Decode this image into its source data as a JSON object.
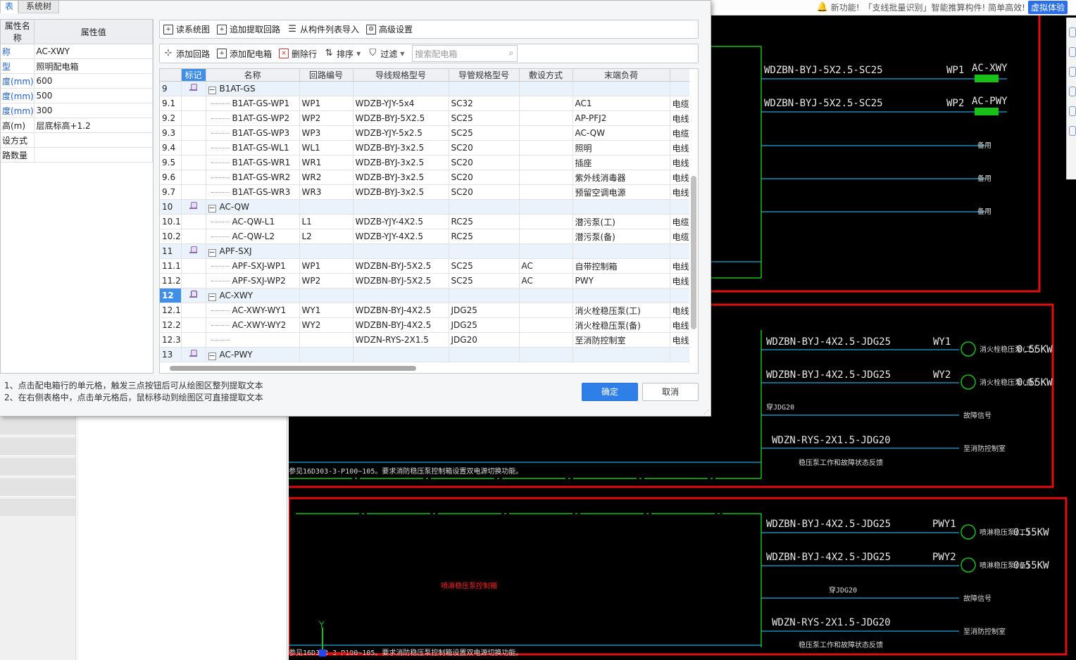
{
  "tabs": [
    "表",
    "系统树"
  ],
  "properties": {
    "header": {
      "name": "属性名称",
      "value": "属性值"
    },
    "rows": [
      {
        "key": "称",
        "value": "AC-XWY",
        "blue": true
      },
      {
        "key": "型",
        "value": "照明配电箱",
        "blue": true
      },
      {
        "key": "度(mm)",
        "value": "600",
        "blue": true
      },
      {
        "key": "度(mm)",
        "value": "500",
        "blue": true
      },
      {
        "key": "度(mm)",
        "value": "300",
        "blue": true
      },
      {
        "key": "高(m)",
        "value": "层底标高+1.2",
        "blue": false
      },
      {
        "key": "设方式",
        "value": "",
        "blue": false
      },
      {
        "key": "路数量",
        "value": "",
        "blue": false
      }
    ]
  },
  "toolbar1": {
    "read_system": "读系统图",
    "append_extract": "追加提取回路",
    "import_list": "从构件列表导入",
    "advanced": "高级设置"
  },
  "toolbar2": {
    "add_circuit": "添加回路",
    "add_box": "添加配电箱",
    "delete_row": "删除行",
    "sort": "排序",
    "filter": "过滤",
    "search_placeholder": "搜索配电箱"
  },
  "grid": {
    "headers": [
      "",
      "标记",
      "名称",
      "回路编号",
      "导线规格型号",
      "导管规格型号",
      "敷设方式",
      "末端负荷",
      ""
    ],
    "rows": [
      {
        "num": "9",
        "group": true,
        "name": "B1AT-GS",
        "circuit": "",
        "wire": "",
        "pipe": "",
        "laying": "",
        "load": "",
        "extra": ""
      },
      {
        "num": "9.1",
        "name": "B1AT-GS-WP1",
        "circuit": "WP1",
        "wire": "WDZB-YJY-5x4",
        "pipe": "SC32",
        "laying": "",
        "load": "AC1",
        "extra": "电缆"
      },
      {
        "num": "9.2",
        "name": "B1AT-GS-WP2",
        "circuit": "WP2",
        "wire": "WDZB-BYJ-5X2.5",
        "pipe": "SC25",
        "laying": "",
        "load": "AP-PFJ2",
        "extra": "电线"
      },
      {
        "num": "9.3",
        "name": "B1AT-GS-WP3",
        "circuit": "WP3",
        "wire": "WDZB-YJY-5x2.5",
        "pipe": "SC25",
        "laying": "",
        "load": "AC-QW",
        "extra": "电缆"
      },
      {
        "num": "9.4",
        "name": "B1AT-GS-WL1",
        "circuit": "WL1",
        "wire": "WDZB-BYJ-3x2.5",
        "pipe": "SC20",
        "laying": "",
        "load": "照明",
        "extra": "电线"
      },
      {
        "num": "9.5",
        "name": "B1AT-GS-WR1",
        "circuit": "WR1",
        "wire": "WDZB-BYJ-3x2.5",
        "pipe": "SC20",
        "laying": "",
        "load": "插座",
        "extra": "电线"
      },
      {
        "num": "9.6",
        "name": "B1AT-GS-WR2",
        "circuit": "WR2",
        "wire": "WDZB-BYJ-3x2.5",
        "pipe": "SC20",
        "laying": "",
        "load": "紫外线消毒器",
        "extra": "电线"
      },
      {
        "num": "9.7",
        "name": "B1AT-GS-WR3",
        "circuit": "WR3",
        "wire": "WDZB-BYJ-3x2.5",
        "pipe": "SC20",
        "laying": "",
        "load": "预留空调电源",
        "extra": "电线"
      },
      {
        "num": "10",
        "group": true,
        "name": "AC-QW",
        "circuit": "",
        "wire": "",
        "pipe": "",
        "laying": "",
        "load": "",
        "extra": ""
      },
      {
        "num": "10.1",
        "name": "AC-QW-L1",
        "circuit": "L1",
        "wire": "WDZB-YJY-4X2.5",
        "pipe": "RC25",
        "laying": "",
        "load": "潜污泵(工)",
        "extra": "电缆"
      },
      {
        "num": "10.2",
        "name": "AC-QW-L2",
        "circuit": "L2",
        "wire": "WDZB-YJY-4X2.5",
        "pipe": "RC25",
        "laying": "",
        "load": "潜污泵(备)",
        "extra": "电缆"
      },
      {
        "num": "11",
        "group": true,
        "name": "APF-SXJ",
        "circuit": "",
        "wire": "",
        "pipe": "",
        "laying": "",
        "load": "",
        "extra": ""
      },
      {
        "num": "11.1",
        "name": "APF-SXJ-WP1",
        "circuit": "WP1",
        "wire": "WDZBN-BYJ-5X2.5",
        "pipe": "SC25",
        "laying": "AC",
        "load": "自带控制箱",
        "extra": "电线"
      },
      {
        "num": "11.2",
        "name": "APF-SXJ-WP2",
        "circuit": "WP2",
        "wire": "WDZBN-BYJ-5X2.5",
        "pipe": "SC25",
        "laying": "AC",
        "load": "PWY",
        "extra": "电线"
      },
      {
        "num": "12",
        "group": true,
        "selected": true,
        "name": "AC-XWY",
        "circuit": "",
        "wire": "",
        "pipe": "",
        "laying": "",
        "load": "",
        "extra": ""
      },
      {
        "num": "12.1",
        "name": "AC-XWY-WY1",
        "circuit": "WY1",
        "wire": "WDZBN-BYJ-4X2.5",
        "pipe": "JDG25",
        "laying": "",
        "load": "消火栓稳压泵(工)",
        "extra": "电线"
      },
      {
        "num": "12.2",
        "name": "AC-XWY-WY2",
        "circuit": "WY2",
        "wire": "WDZBN-BYJ-4X2.5",
        "pipe": "JDG25",
        "laying": "",
        "load": "消火栓稳压泵(备)",
        "extra": "电线"
      },
      {
        "num": "12.3",
        "name": "",
        "circuit": "",
        "wire": "WDZN-RYS-2X1.5",
        "pipe": "JDG20",
        "laying": "",
        "load": "至消防控制室",
        "extra": "电线"
      },
      {
        "num": "13",
        "group": true,
        "name": "AC-PWY",
        "circuit": "",
        "wire": "",
        "pipe": "",
        "laying": "",
        "load": "",
        "extra": ""
      }
    ]
  },
  "tips": {
    "line1": "1、点击配电箱行的单元格，触发三点按钮后可从绘图区整列提取文本",
    "line2": "2、在右侧表格中，点击单元格后，鼠标移动到绘图区可直接提取文本"
  },
  "buttons": {
    "ok": "确定",
    "cancel": "取消"
  },
  "notice": {
    "new_feature": "新功能!",
    "message": "「支线批量识别」智能推算构件! 简单高效!",
    "try": "虚拟体验"
  },
  "cad": {
    "circuits_top": [
      {
        "wire": "WDZBN-BYJ-5X2.5-SC25",
        "code": "WP1",
        "box": "AC-XWY"
      },
      {
        "wire": "WDZBN-BYJ-5X2.5-SC25",
        "code": "WP2",
        "box": "AC-PWY"
      }
    ],
    "spare": "备用",
    "circuits_mid": [
      {
        "wire": "WDZBN-BYJ-4X2.5-JDG25",
        "code": "WY1",
        "load": "消火栓稳压泵(工)",
        "power": "0.55KW"
      },
      {
        "wire": "WDZBN-BYJ-4X2.5-JDG25",
        "code": "WY2",
        "load": "消火栓稳压泵(备)",
        "power": "0.55KW"
      }
    ],
    "pipe_label": "穿JDG20",
    "cable_label": "WDZN-RYS-2X1.5-JDG20",
    "fault_signal": "故障信号",
    "to_fire_control": "至消防控制室",
    "note": "稳压泵工作和故障状态反馈",
    "ref_text": "参见16D303-3-P100~105。要求消防稳压泵控制箱设置双电源切换功能。",
    "circuits_bot": [
      {
        "wire": "WDZBN-BYJ-4X2.5-JDG25",
        "code": "PWY1",
        "load": "喷淋稳压泵(工)",
        "power": "0.55KW"
      },
      {
        "wire": "WDZBN-BYJ-4X2.5-JDG25",
        "code": "PWY2",
        "load": "喷淋稳压泵(备)",
        "power": "0.55KW"
      }
    ],
    "red_text": "喷淋稳压泵控制箱",
    "axis_y": "Y"
  }
}
